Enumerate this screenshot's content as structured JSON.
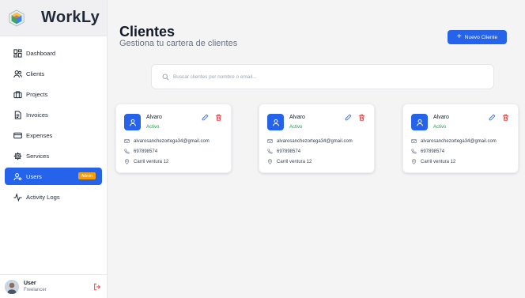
{
  "app": {
    "name": "WorkLy"
  },
  "sidebar": {
    "items": [
      {
        "label": "Dashboard",
        "icon": "dashboard-icon"
      },
      {
        "label": "Clients",
        "icon": "clients-icon"
      },
      {
        "label": "Projects",
        "icon": "briefcase-icon"
      },
      {
        "label": "Invoices",
        "icon": "invoice-icon"
      },
      {
        "label": "Expenses",
        "icon": "credit-card-icon"
      },
      {
        "label": "Services",
        "icon": "gear-icon"
      },
      {
        "label": "Users",
        "icon": "users-icon",
        "badge": "Admin",
        "active": true
      },
      {
        "label": "Activity Logs",
        "icon": "activity-icon"
      }
    ],
    "footer": {
      "name": "User",
      "role": "Freelancer"
    }
  },
  "header": {
    "title": "Clientes",
    "subtitle": "Gestiona tu cartera de clientes",
    "new_button": "Nuevo Cliente"
  },
  "search": {
    "placeholder": "Buscar clientes por nombre o email...",
    "value": ""
  },
  "clients": [
    {
      "name": "Alvaro",
      "status": "Activo",
      "email": "alvarosanchezortega34@gmail.com",
      "phone": "697898574",
      "address": "Carril ventura 12"
    },
    {
      "name": "Alvaro",
      "status": "Activo",
      "email": "alvarosanchezortega34@gmail.com",
      "phone": "697898574",
      "address": "Carril ventura 12"
    },
    {
      "name": "Alvaro",
      "status": "Activo",
      "email": "alvarosanchezortega34@gmail.com",
      "phone": "697898574",
      "address": "Carril ventura 12"
    }
  ],
  "colors": {
    "accent": "#2563eb",
    "active_status": "#16a34a",
    "badge": "#f59e0b",
    "danger": "#dc2626"
  }
}
